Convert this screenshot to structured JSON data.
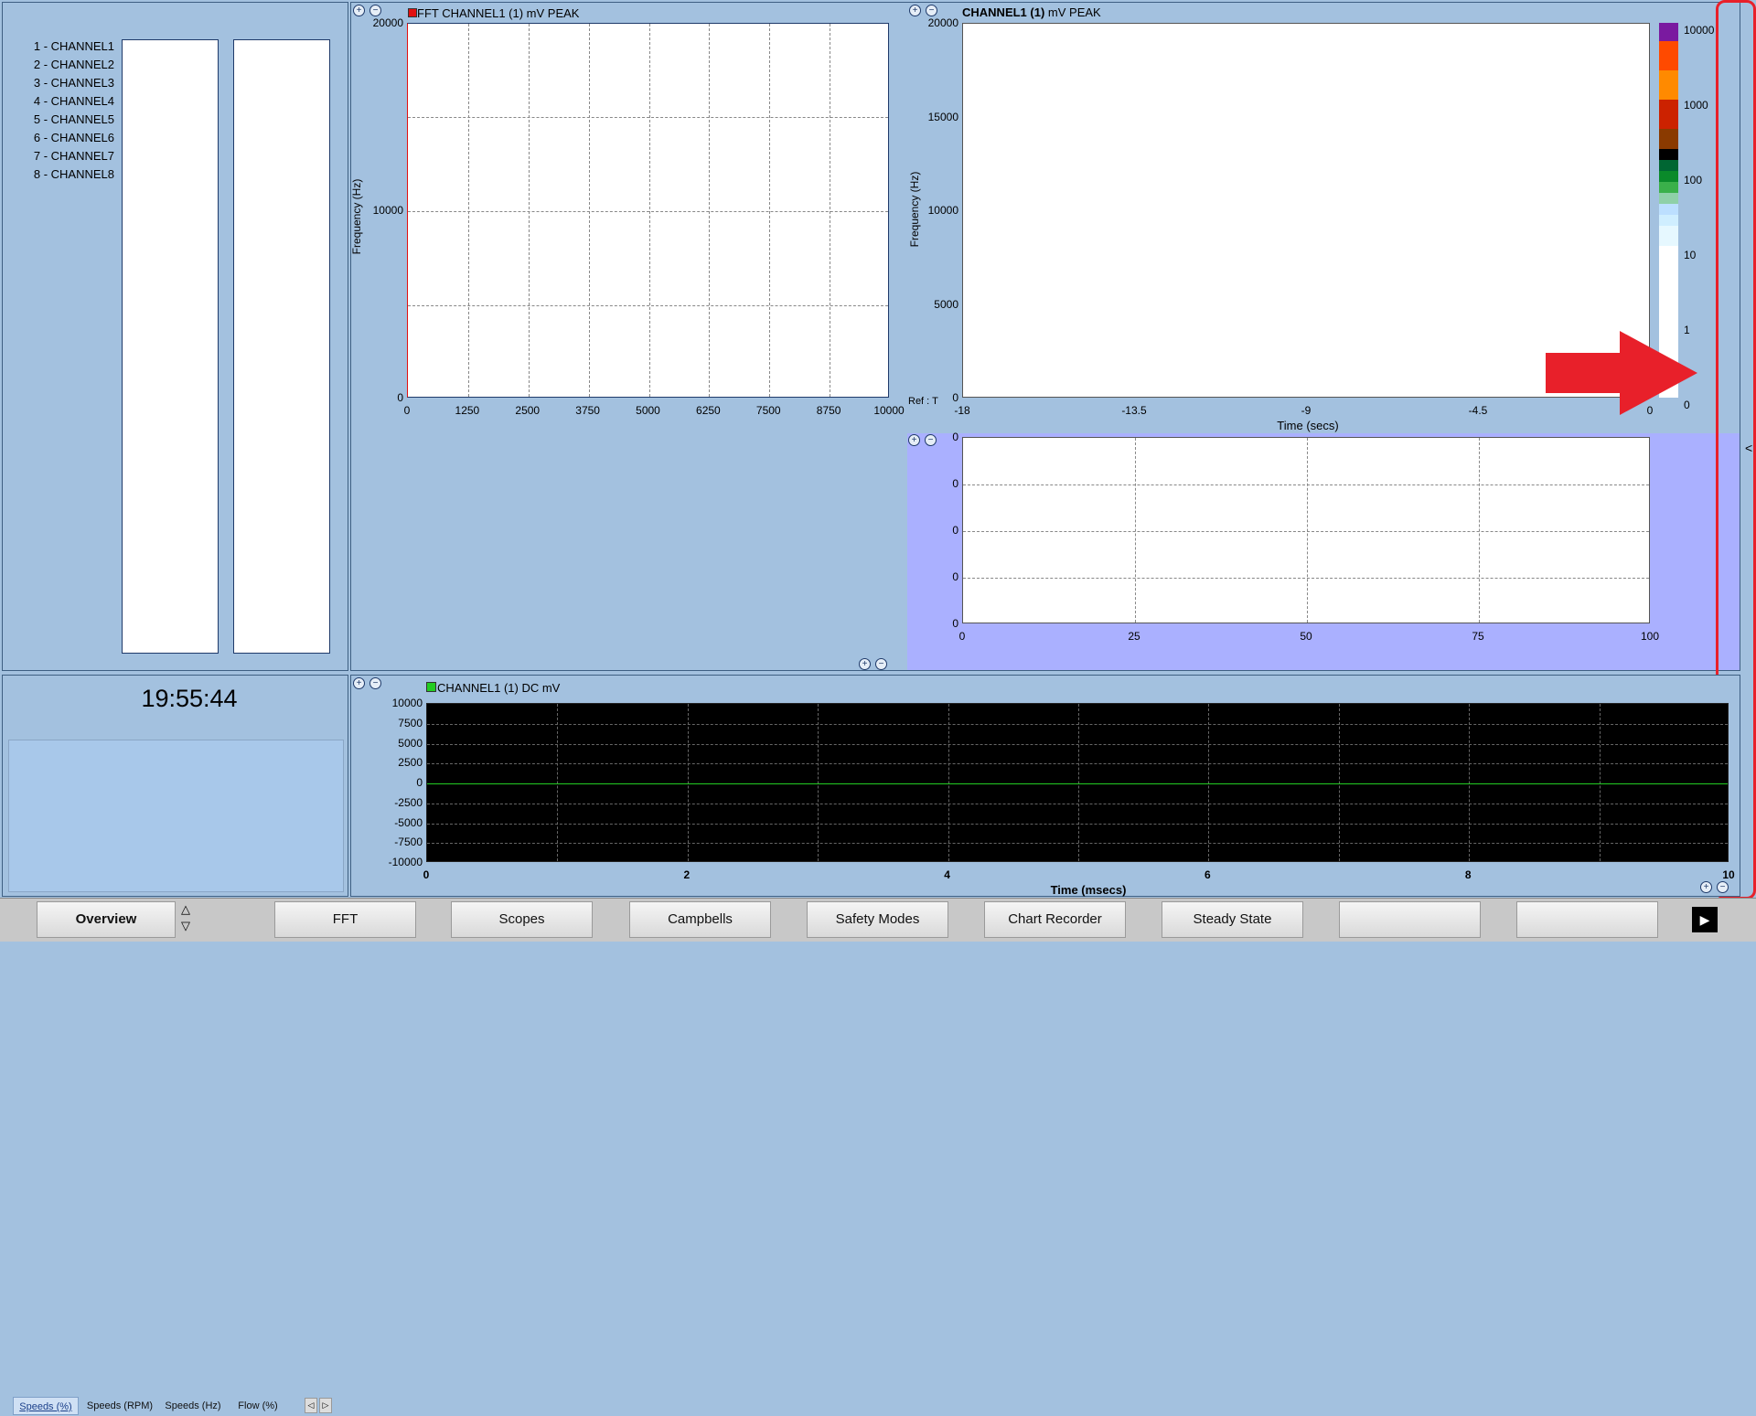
{
  "channel_list": [
    "1 - CHANNEL1",
    "2 - CHANNEL2",
    "3 - CHANNEL3",
    "4 - CHANNEL4",
    "5 - CHANNEL5",
    "6 - CHANNEL6",
    "7 - CHANNEL7",
    "8 - CHANNEL8"
  ],
  "clock": "19:55:44",
  "speed_tabs": [
    "Speeds (%)",
    "Speeds (RPM)",
    "Speeds (Hz)",
    "Flow (%)"
  ],
  "fft_chart": {
    "title": "FFT CHANNEL1 (1) mV PEAK",
    "ylabel": "Frequency (Hz)",
    "yticks": [
      "20000",
      "10000",
      "0"
    ],
    "xticks": [
      "0",
      "1250",
      "2500",
      "3750",
      "5000",
      "6250",
      "7500",
      "8750",
      "10000"
    ],
    "legend_color": "#e01010"
  },
  "waterfall_chart": {
    "title_bold": "CHANNEL1 (1)",
    "title_rest": " mV PEAK",
    "ylabel": "Frequency (Hz)",
    "xlabel": "Time (secs)",
    "ref_label": "Ref : T",
    "yticks": [
      "20000",
      "15000",
      "10000",
      "5000",
      "0"
    ],
    "xticks": [
      "-18",
      "-13.5",
      "-9",
      "-4.5",
      "0"
    ],
    "colorbar_labels": [
      "10000",
      "1000",
      "100",
      "10",
      "1",
      "0"
    ]
  },
  "small_chart": {
    "yticks": [
      "0",
      "0",
      "0",
      "0",
      "0"
    ],
    "xticks": [
      "0",
      "25",
      "50",
      "75",
      "100"
    ]
  },
  "dc_chart": {
    "title": "CHANNEL1 (1) DC mV",
    "xlabel": "Time (msecs)",
    "yticks": [
      "10000",
      "7500",
      "5000",
      "2500",
      "0",
      "-2500",
      "-5000",
      "-7500",
      "-10000"
    ],
    "xticks": [
      "0",
      "2",
      "4",
      "6",
      "8",
      "10"
    ],
    "legend_color": "#22cc22",
    "trace_color": "#22cc22"
  },
  "collapse_arrow": "<",
  "nav": {
    "buttons": [
      "Overview",
      "FFT",
      "Scopes",
      "Campbells",
      "Safety Modes",
      "Chart Recorder",
      "Steady State",
      "",
      ""
    ],
    "active": "Overview"
  }
}
